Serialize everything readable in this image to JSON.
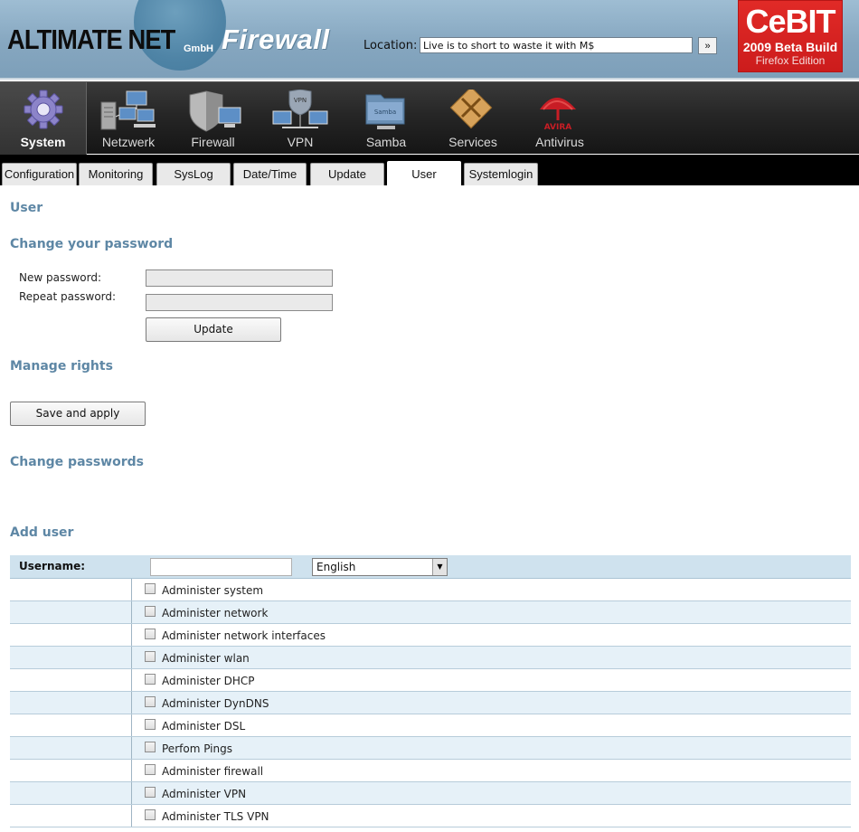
{
  "header": {
    "logo_text": "ALTIMATE NET",
    "logo_suffix": "GmbH",
    "product": "Firewall",
    "location_label": "Location:",
    "location_value": "Live is to short to waste it with M$",
    "go_label": "»",
    "badge": {
      "brand": "CeBIT",
      "line2": "2009 Beta Build",
      "line3": "Firefox Edition",
      "color": "#d42020"
    }
  },
  "nav": {
    "items": [
      {
        "label": "System",
        "icon": "gear-icon",
        "active": true
      },
      {
        "label": "Netzwerk",
        "icon": "network-icon"
      },
      {
        "label": "Firewall",
        "icon": "shield-icon"
      },
      {
        "label": "VPN",
        "icon": "vpn-icon"
      },
      {
        "label": "Samba",
        "icon": "folder-icon"
      },
      {
        "label": "Services",
        "icon": "tools-icon"
      },
      {
        "label": "Antivirus",
        "icon": "umbrella-icon",
        "badge_text": "AVIRA"
      }
    ]
  },
  "subtabs": [
    "Configuration",
    "Monitoring",
    "SysLog",
    "Date/Time",
    "Update",
    "User",
    "Systemlogin"
  ],
  "active_subtab": "User",
  "content": {
    "page_title": "User",
    "change_password_title": "Change your password",
    "new_password_label": "New password:",
    "repeat_password_label": "Repeat password:",
    "update_button": "Update",
    "manage_rights_title": "Manage rights",
    "save_apply_button": "Save and apply",
    "change_passwords_title": "Change passwords",
    "add_user_title": "Add user"
  },
  "user_table": {
    "username_label": "Username:",
    "username_value": "",
    "language": "English",
    "permissions": [
      "Administer system",
      "Administer network",
      "Administer network interfaces",
      "Administer wlan",
      "Administer DHCP",
      "Administer DynDNS",
      "Administer DSL",
      "Perfom Pings",
      "Administer firewall",
      "Administer VPN",
      "Administer TLS VPN"
    ]
  },
  "colors": {
    "section_title": "#5e87a5",
    "header_bg": "#8fb0c8",
    "nav_bg": "#222222",
    "table_alt_row": "#e6f1f8"
  }
}
